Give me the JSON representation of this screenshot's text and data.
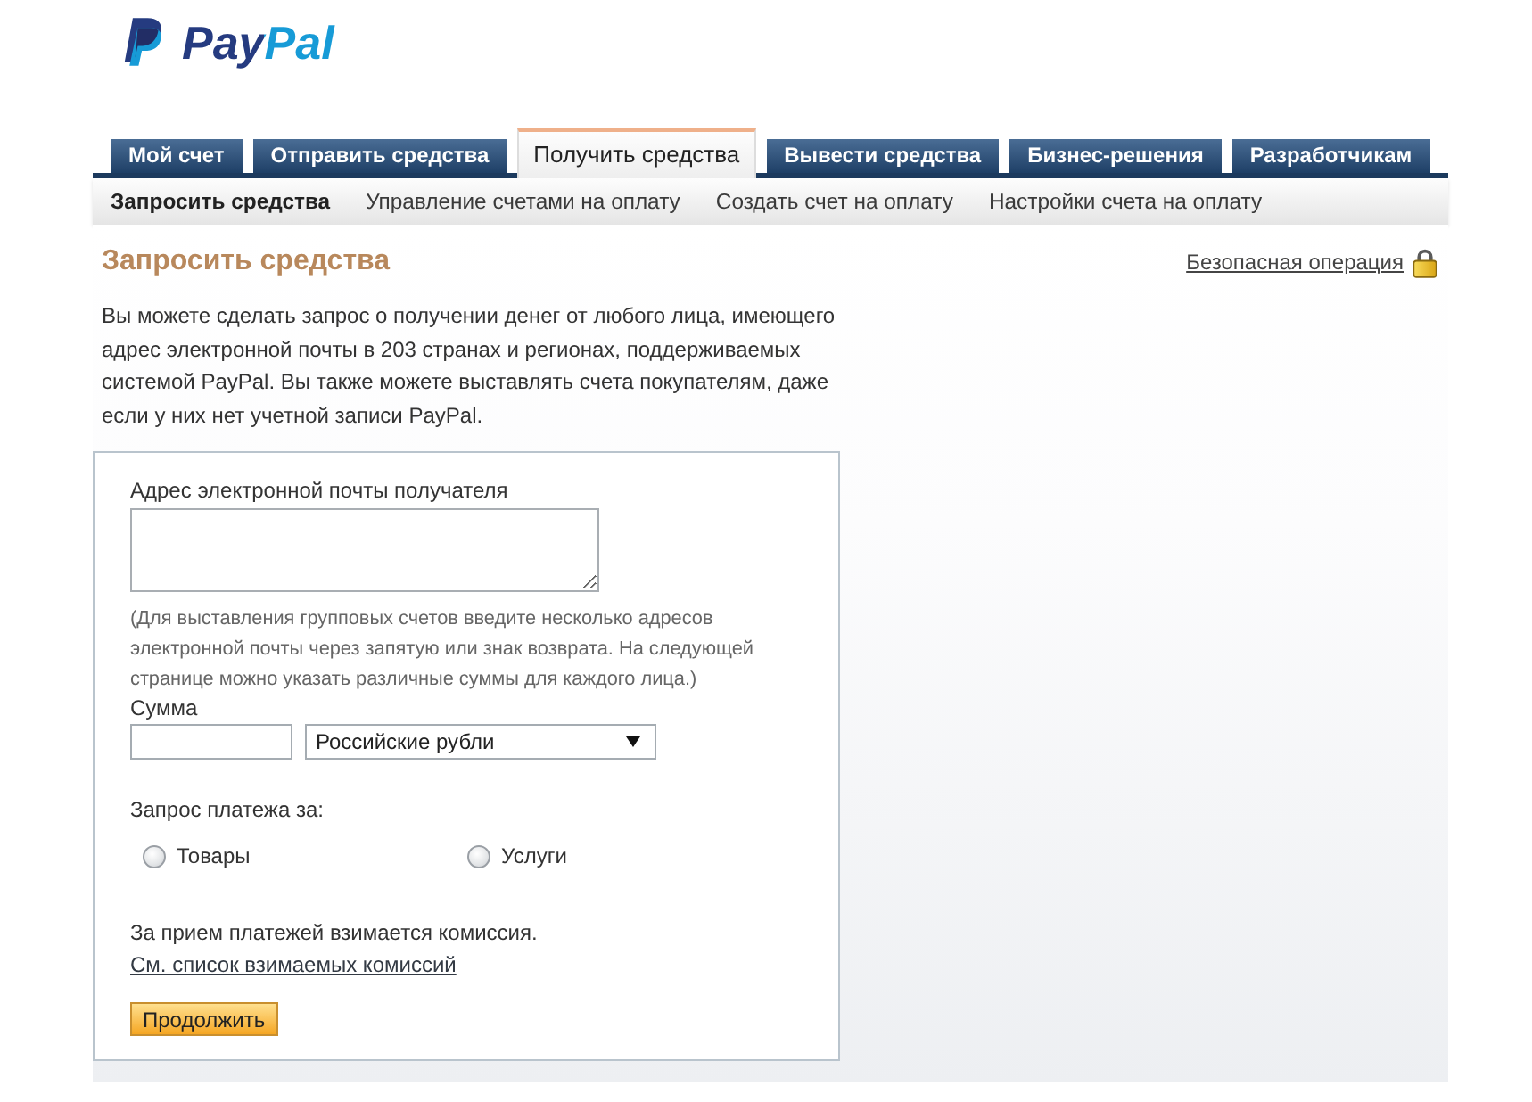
{
  "logo": {
    "wordmark": "PayPal"
  },
  "tabs": [
    {
      "label": "Мой счет",
      "selected": false
    },
    {
      "label": "Отправить средства",
      "selected": false
    },
    {
      "label": "Получить средства",
      "selected": true
    },
    {
      "label": "Вывести средства",
      "selected": false
    },
    {
      "label": "Бизнес-решения",
      "selected": false
    },
    {
      "label": "Разработчикам",
      "selected": false
    }
  ],
  "subnav": [
    {
      "label": "Запросить средства",
      "selected": true
    },
    {
      "label": "Управление счетами на оплату",
      "selected": false
    },
    {
      "label": "Создать счет на оплату",
      "selected": false
    },
    {
      "label": "Настройки счета на оплату",
      "selected": false
    }
  ],
  "page": {
    "title": "Запросить средства",
    "secure_link": "Безопасная операция",
    "intro": "Вы можете сделать запрос о получении денег от любого лица, имеющего адрес электронной почты в 203 странах и регионах, поддерживаемых системой PayPal. Вы также можете выставлять счета покупателям, даже если у них нет учетной записи PayPal."
  },
  "form": {
    "recipient_label": "Адрес электронной почты получателя",
    "recipient_hint": "(Для выставления групповых счетов введите несколько адресов электронной почты через запятую или знак возврата. На следующей странице можно указать различные суммы для каждого лица.)",
    "amount_label": "Сумма",
    "currency": "Российские рубли",
    "payment_for_label": "Запрос платежа за:",
    "payment_options": [
      {
        "label": "Товары",
        "selected": false
      },
      {
        "label": "Услуги",
        "selected": false
      }
    ],
    "fee_note": "За прием платежей взимается комиссия.",
    "fee_link": "См. список взимаемых комиссий",
    "continue_button": "Продолжить"
  }
}
